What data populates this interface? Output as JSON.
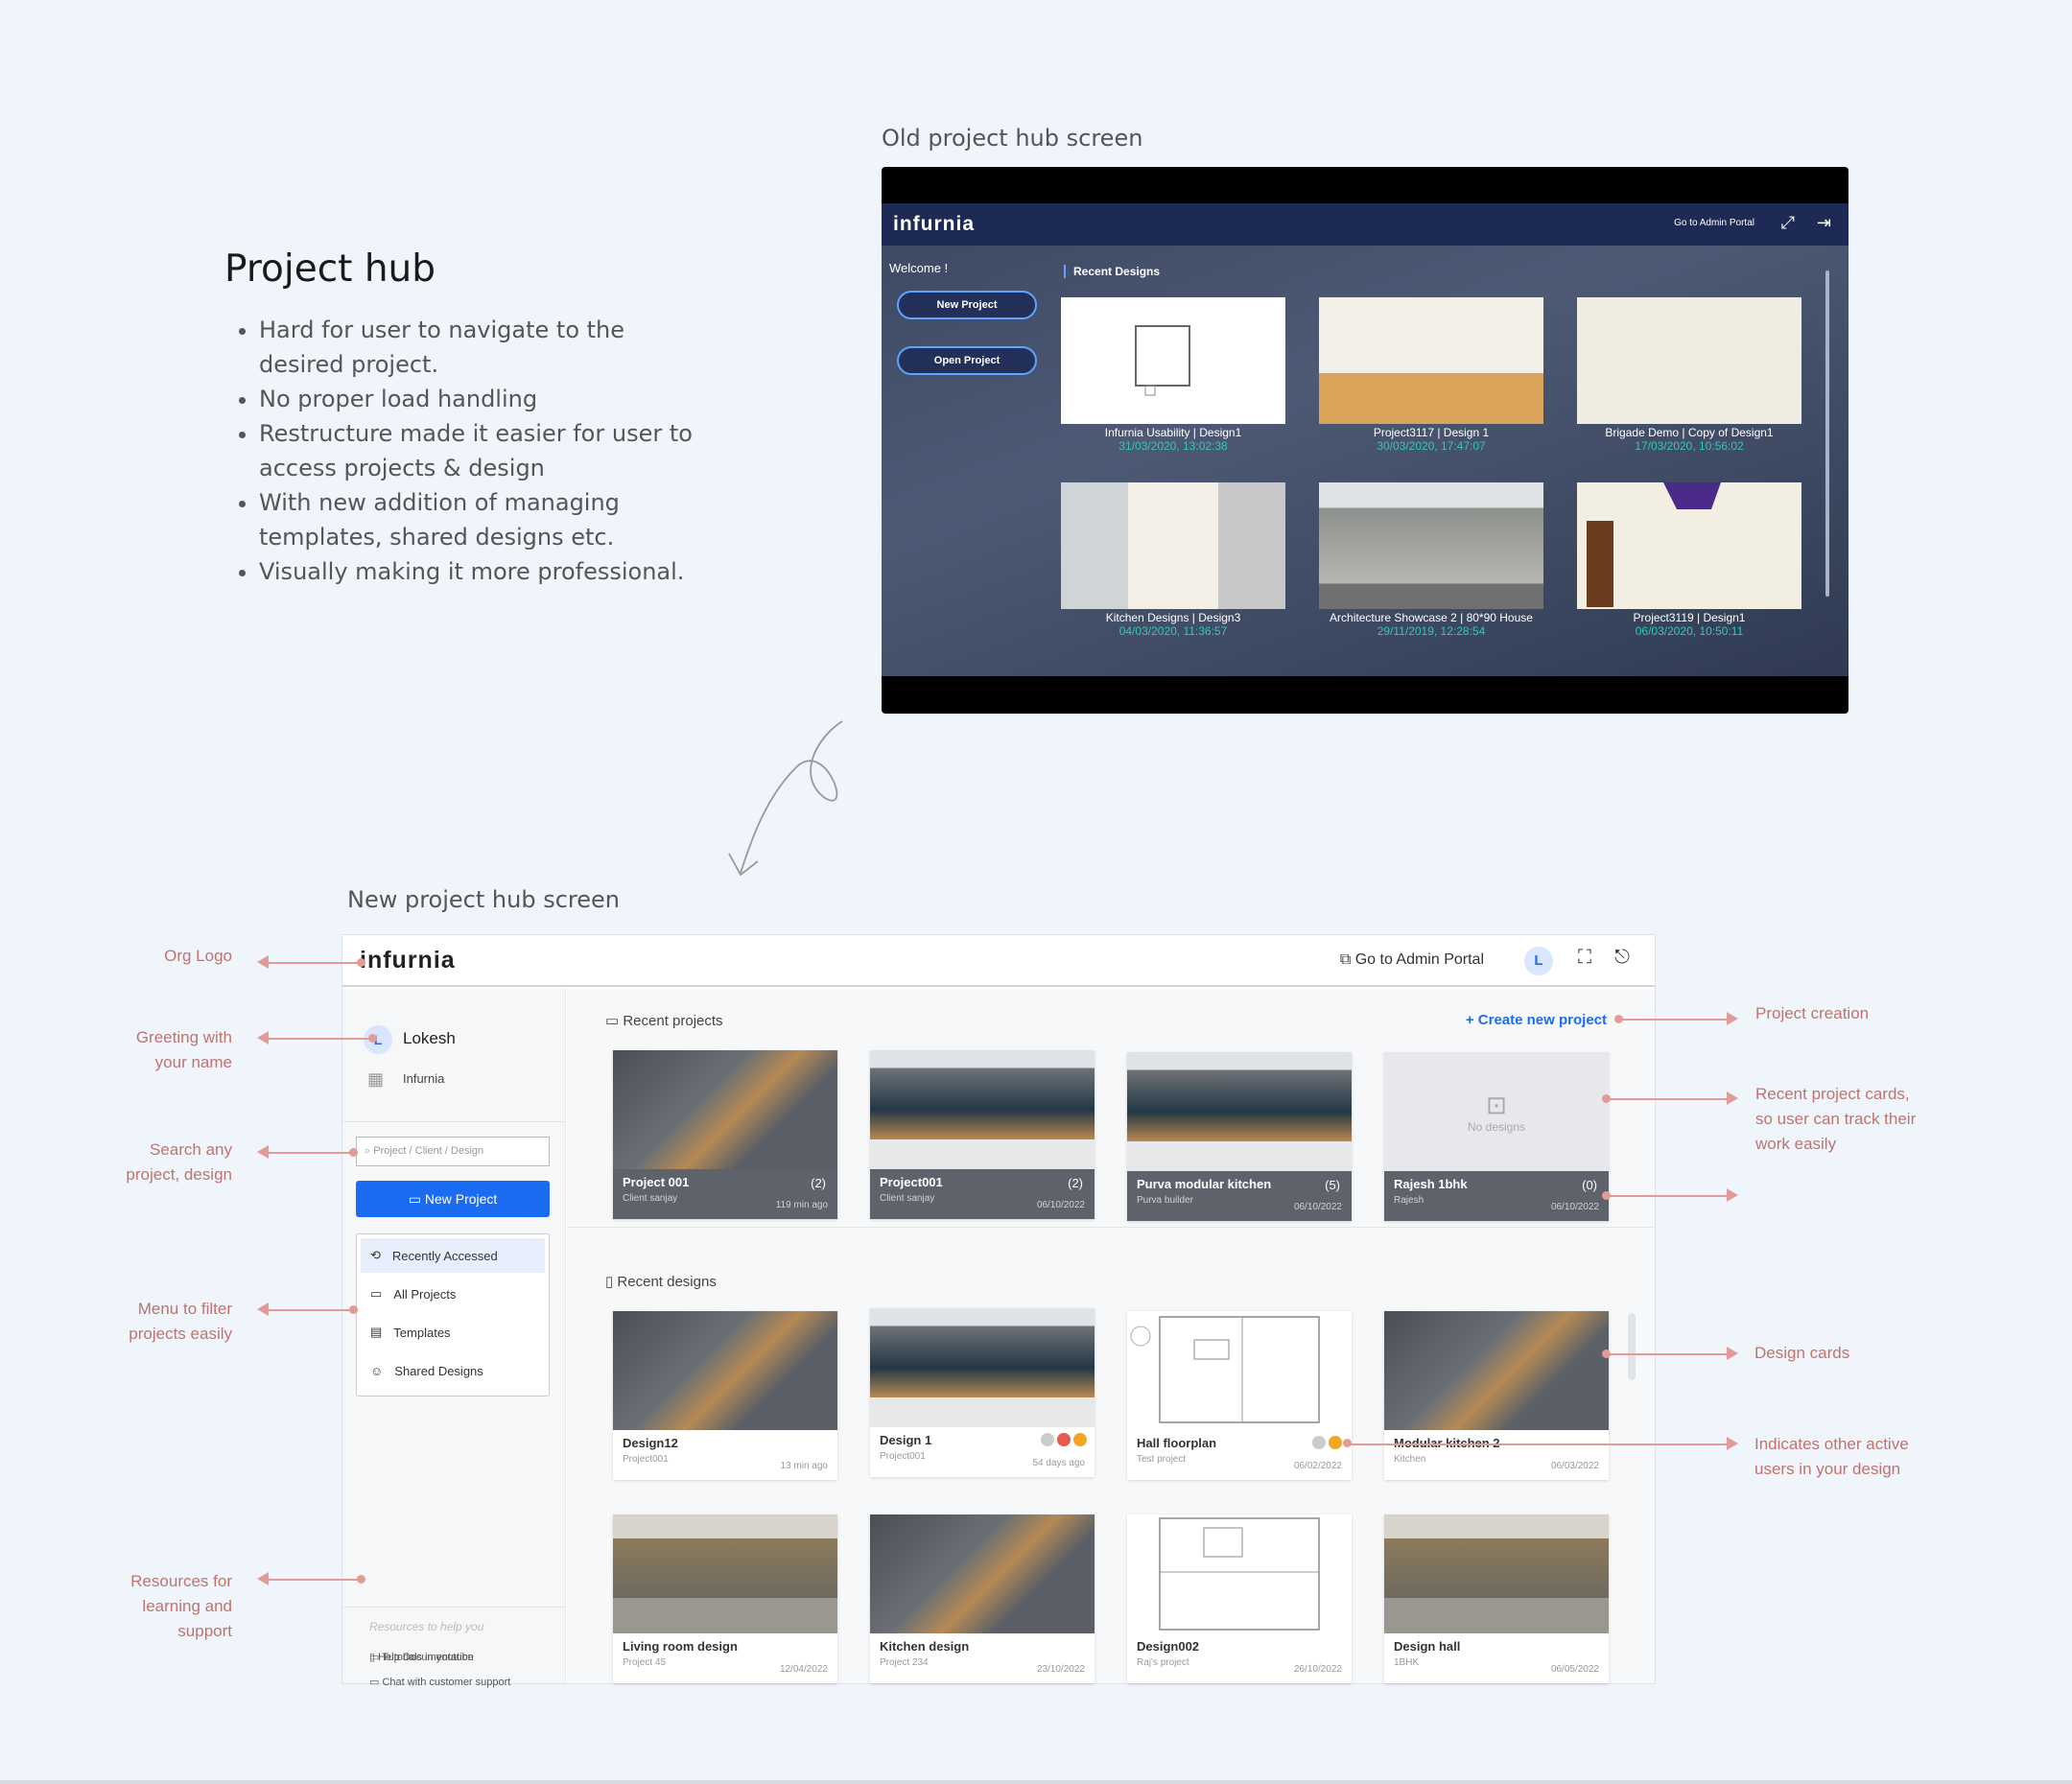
{
  "intro": {
    "title": "Project hub",
    "points": [
      "Hard for user to navigate to the desired project.",
      "No proper load handling",
      "Restructure made it easier for user to access projects & design",
      "With new addition of managing templates, shared designs etc.",
      "Visually making it more professional."
    ]
  },
  "old_caption": "Old  project hub screen",
  "new_caption": "New  project hub screen",
  "old": {
    "logo": "infurnia",
    "admin": "Go to Admin Portal",
    "welcome": "Welcome !",
    "new_btn": "New Project",
    "open_btn": "Open Project",
    "recent": "Recent Designs",
    "cards": [
      {
        "name": "Infurnia Usability | Design1",
        "date": "31/03/2020, 13:02:38"
      },
      {
        "name": "Project3117 | Design 1",
        "date": "30/03/2020, 17:47:07"
      },
      {
        "name": "Brigade Demo | Copy of Design1",
        "date": "17/03/2020, 10:56:02"
      },
      {
        "name": "Kitchen Designs | Design3",
        "date": "04/03/2020, 11:36:57"
      },
      {
        "name": "Architecture Showcase 2 | 80*90 House",
        "date": "29/11/2019, 12:28:54"
      },
      {
        "name": "Project3119 | Design1",
        "date": "06/03/2020, 10:50:11"
      }
    ]
  },
  "app": {
    "logo": "infurnia",
    "admin_link": "Go to Admin Portal",
    "avatar": "L",
    "user": {
      "initial": "L",
      "name": "Lokesh",
      "org": "Infurnia"
    },
    "search_placeholder": "Project / Client / Design",
    "new_project": "New Project",
    "menu": [
      "Recently Accessed",
      "All Projects",
      "Templates",
      "Shared Designs"
    ],
    "resources_title": "Resources to help you",
    "resources": [
      "Tutorials in youtube",
      "Chat with customer support",
      "Help Documentation"
    ],
    "recent_projects_title": "Recent projects",
    "create_link": "+ Create new project",
    "no_designs": "No designs",
    "projects": [
      {
        "name": "Project 001",
        "count": "(2)",
        "client": "Client sanjay",
        "date": "119 min ago"
      },
      {
        "name": "Project001",
        "count": "(2)",
        "client": "Client sanjay",
        "date": "06/10/2022"
      },
      {
        "name": "Purva modular kitchen",
        "count": "(5)",
        "client": "Purva builder",
        "date": "06/10/2022"
      },
      {
        "name": "Rajesh 1bhk",
        "count": "(0)",
        "client": "Rajesh",
        "date": "06/10/2022"
      }
    ],
    "recent_designs_title": "Recent designs",
    "designs": [
      {
        "name": "Design12",
        "project": "Project001",
        "date": "13 min ago"
      },
      {
        "name": "Design 1",
        "project": "Project001",
        "date": "54 days ago"
      },
      {
        "name": "Hall floorplan",
        "project": "Test project",
        "date": "06/02/2022"
      },
      {
        "name": "Modular kitchen 2",
        "project": "Kitchen",
        "date": "06/03/2022"
      },
      {
        "name": "Living room design",
        "project": "Project 45",
        "date": "12/04/2022"
      },
      {
        "name": "Kitchen design",
        "project": "Project 234",
        "date": "23/10/2022"
      },
      {
        "name": "Design002",
        "project": "Raj's project",
        "date": "26/10/2022"
      },
      {
        "name": "Design hall",
        "project": "1BHK",
        "date": "06/05/2022"
      }
    ]
  },
  "annotations": {
    "org_logo": "Org Logo",
    "greeting_1": "Greeting with",
    "greeting_2": "your name",
    "search_1": "Search any",
    "search_2": "project, design",
    "menu_1": "Menu to filter",
    "menu_2": "projects easily",
    "resources_1": "Resources for",
    "resources_2": "learning and",
    "resources_3": "support",
    "creation": "Project creation",
    "cards_1": "Recent project cards,",
    "cards_2": "so user can track their",
    "cards_3": "work easily",
    "design_cards": "Design cards",
    "active_1": "Indicates other active",
    "active_2": "users in your design"
  },
  "colors": {
    "accent": "#1a6df2",
    "annotation": "#c0736e",
    "old_date": "#36c7b4"
  }
}
